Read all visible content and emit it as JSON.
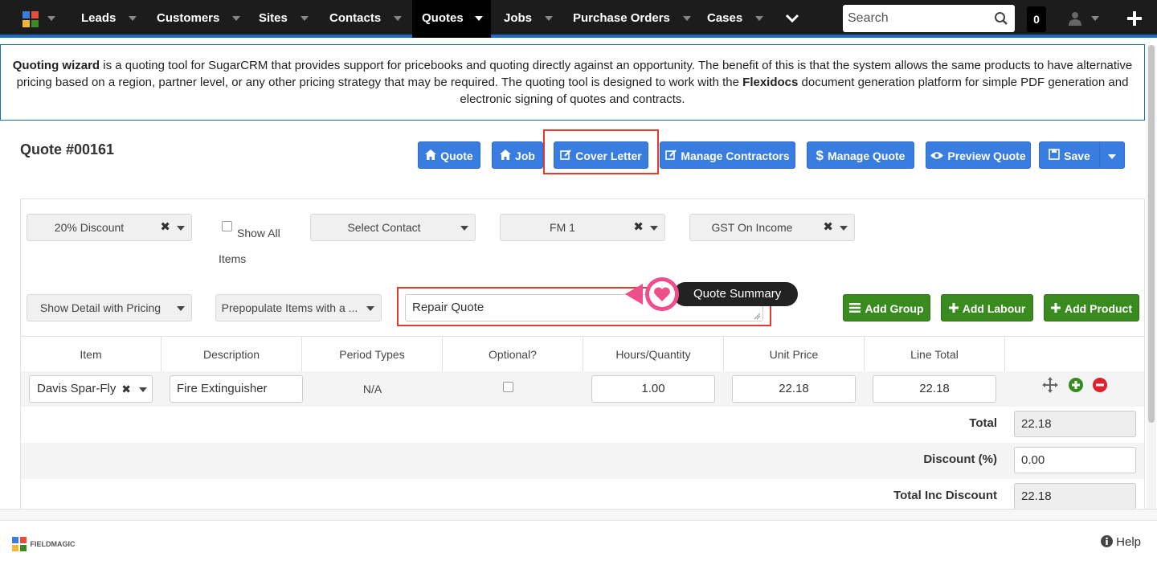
{
  "nav": {
    "items": [
      {
        "label": "Leads"
      },
      {
        "label": "Customers"
      },
      {
        "label": "Sites"
      },
      {
        "label": "Contacts"
      },
      {
        "label": "Quotes"
      },
      {
        "label": "Jobs"
      },
      {
        "label": "Purchase Orders"
      },
      {
        "label": "Cases"
      }
    ],
    "active": "Quotes",
    "search_placeholder": "Search",
    "notification_count": "0",
    "accent_color": "#1a6cc4"
  },
  "info": {
    "bold1": "Quoting wizard",
    "text1": " is a quoting tool for SugarCRM that provides support for pricebooks and quoting directly against an opportunity. The benefit of this is that the system allows the same products to have alternative pricing based on a region, partner level, or any other pricing strategy that may be required. The quoting tool is designed to work with the ",
    "bold2": "Flexidocs",
    "text2": " document generation platform for simple PDF generation and electronic signing of quotes and contracts."
  },
  "page": {
    "title": "Quote #00161"
  },
  "actions": {
    "quote": "Quote",
    "job": "Job",
    "cover_letter": "Cover Letter",
    "manage_contractors": "Manage Contractors",
    "manage_quote": "Manage Quote",
    "preview_quote": "Preview Quote",
    "save": "Save"
  },
  "filters": {
    "discount": "20% Discount",
    "show_all_items": "Show All Items",
    "contact_placeholder": "Select Contact",
    "fm": "FM 1",
    "gst": "GST On Income",
    "detail": "Show Detail with Pricing",
    "prepopulate": "Prepopulate Items with a ..."
  },
  "summary": {
    "value": "Repair Quote",
    "tooltip": "Quote Summary"
  },
  "group_actions": {
    "add_group": "Add Group",
    "add_labour": "Add Labour",
    "add_product": "Add Product"
  },
  "table": {
    "headers": [
      "Item",
      "Description",
      "Period Types",
      "Optional?",
      "Hours/Quantity",
      "Unit Price",
      "Line Total"
    ],
    "row": {
      "item": "Davis Spar-Fly",
      "description": "Fire Extinguisher",
      "period": "N/A",
      "quantity": "1.00",
      "unit_price": "22.18",
      "line_total": "22.18"
    }
  },
  "totals": {
    "total_label": "Total",
    "total_value": "22.18",
    "discount_label": "Discount (%)",
    "discount_value": "0.00",
    "inc_discount_label": "Total Inc Discount",
    "inc_discount_value": "22.18"
  },
  "footer": {
    "brand": "FIELDMAGIC",
    "help": "Help"
  }
}
